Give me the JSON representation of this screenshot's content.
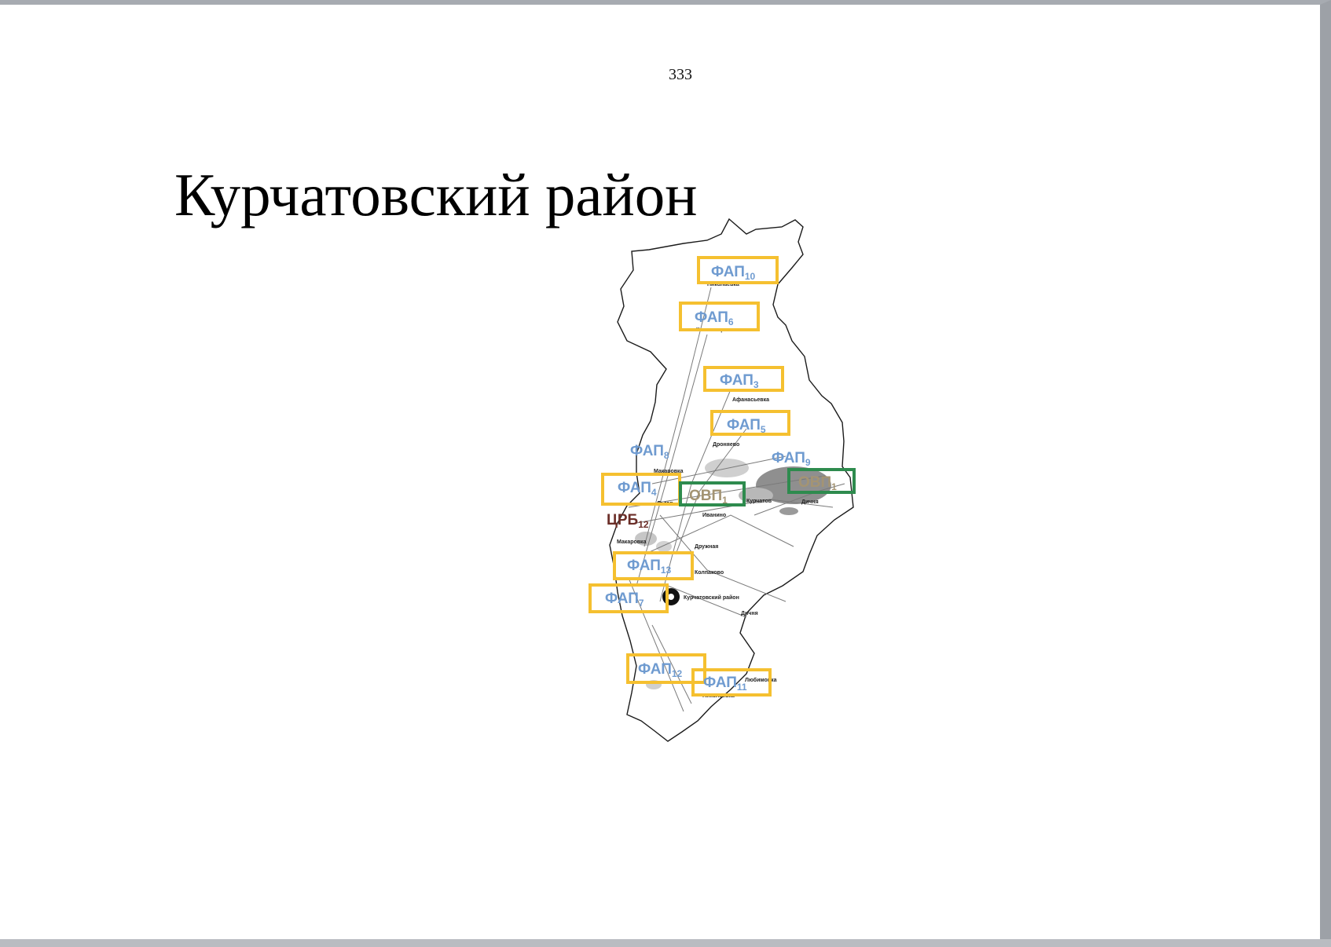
{
  "page_number": "333",
  "title": "Курчатовский район",
  "colors": {
    "fap_box": "#f5c030",
    "ovp_box": "#2e8b4e",
    "fap_text": "#6f9bd0",
    "ovp_text": "#a49473",
    "crb_text": "#6b2e28"
  },
  "map": {
    "facilities": [
      {
        "id": "fap10",
        "base": "ФАП",
        "sub": "10",
        "kind": "fap",
        "boxed": true
      },
      {
        "id": "fap6",
        "base": "ФАП",
        "sub": "6",
        "kind": "fap",
        "boxed": true
      },
      {
        "id": "fap3",
        "base": "ФАП",
        "sub": "3",
        "kind": "fap",
        "boxed": true
      },
      {
        "id": "fap5",
        "base": "ФАП",
        "sub": "5",
        "kind": "fap",
        "boxed": true
      },
      {
        "id": "fap8",
        "base": "ФАП",
        "sub": "8",
        "kind": "fap",
        "boxed": false
      },
      {
        "id": "fap9",
        "base": "ФАП",
        "sub": "9",
        "kind": "fap",
        "boxed": false
      },
      {
        "id": "fap4",
        "base": "ФАП",
        "sub": "4",
        "kind": "fap",
        "boxed": true
      },
      {
        "id": "ovp1",
        "base": "ОВП",
        "sub": "1",
        "kind": "ovp",
        "boxed": true
      },
      {
        "id": "ovp2",
        "base": "ОВП",
        "sub": "1",
        "kind": "ovp",
        "boxed": true
      },
      {
        "id": "crb12",
        "base": "ЦРБ",
        "sub": "12",
        "kind": "crb",
        "boxed": false
      },
      {
        "id": "fap13",
        "base": "ФАП",
        "sub": "13",
        "kind": "fap",
        "boxed": true
      },
      {
        "id": "fap7",
        "base": "ФАП",
        "sub": "7",
        "kind": "fap",
        "boxed": true
      },
      {
        "id": "fap12",
        "base": "ФАП",
        "sub": "12",
        "kind": "fap",
        "boxed": true
      },
      {
        "id": "fap11",
        "base": "ФАП",
        "sub": "11",
        "kind": "fap",
        "boxed": true
      }
    ],
    "places": [
      "Николаевка",
      "Костельцево",
      "Афанасьевка",
      "Дроняево",
      "Макаровка",
      "Льгов",
      "Курчатов",
      "Дичня",
      "Иванино",
      "Дружная",
      "Колпаково",
      "Курчатовский район",
      "Дичня",
      "Любимовка",
      "Николаевка",
      "Макаровка"
    ]
  }
}
